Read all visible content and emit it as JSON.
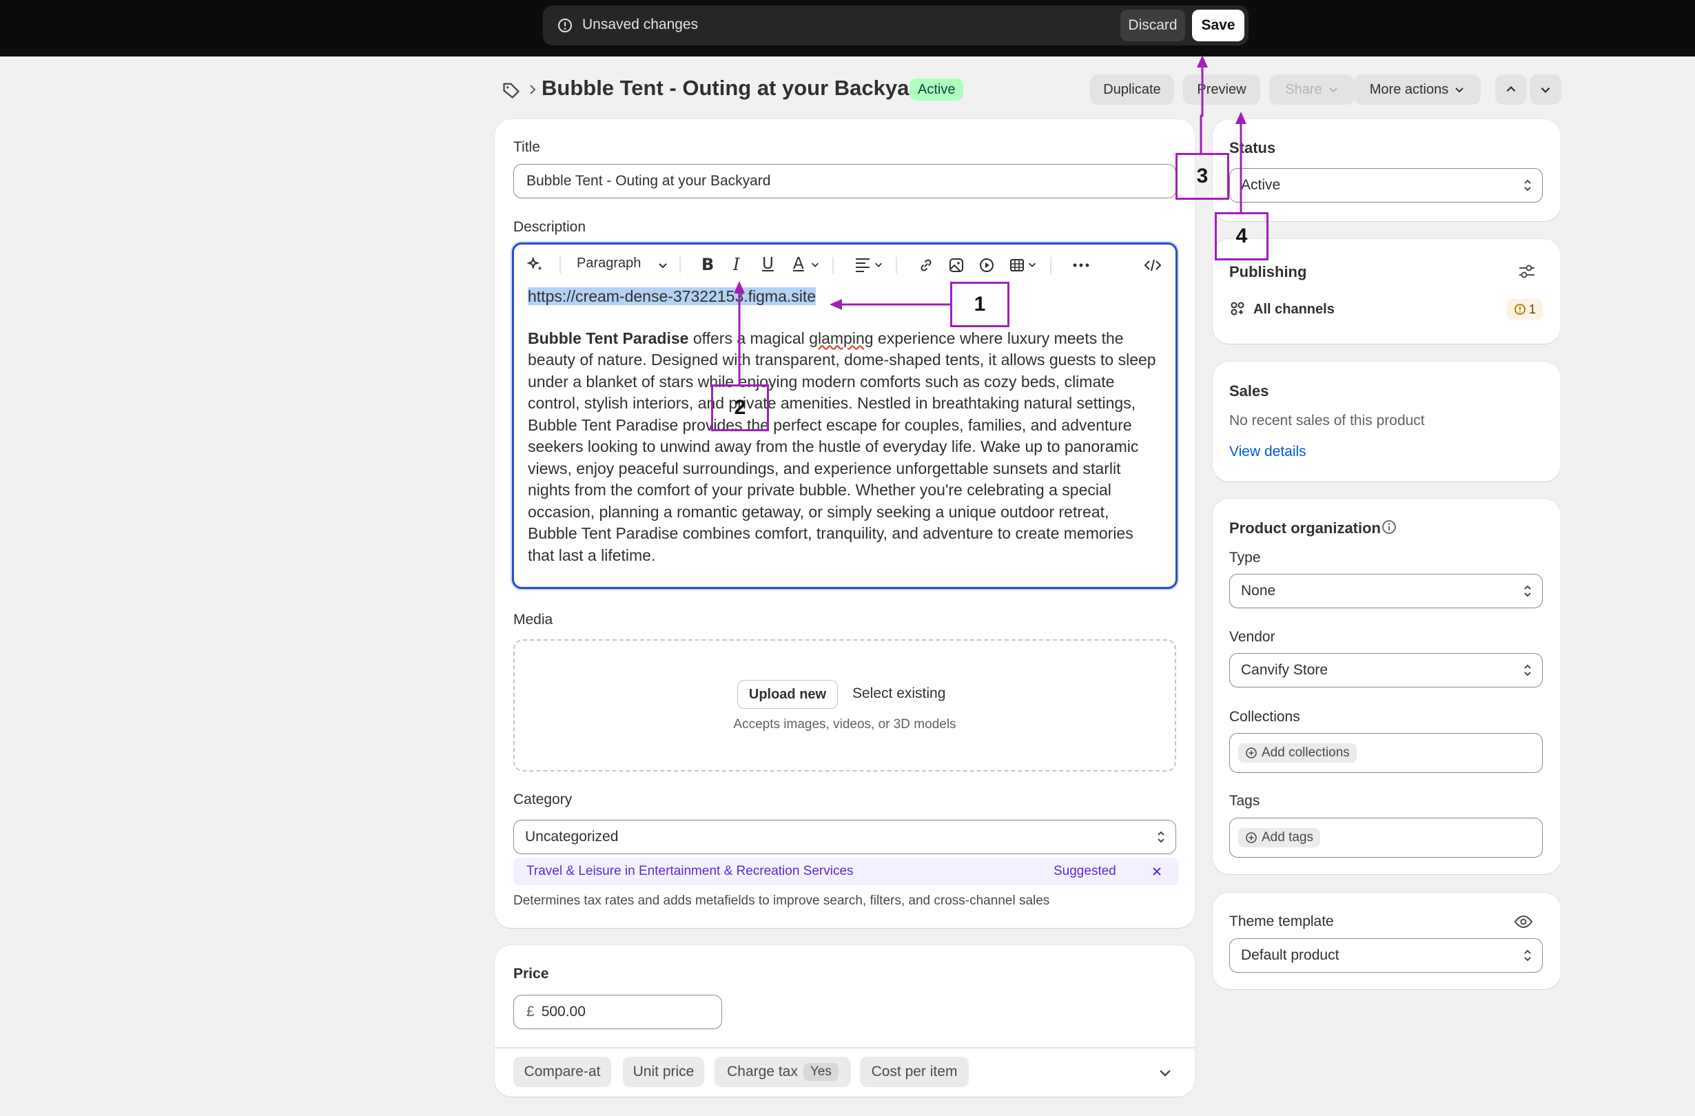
{
  "save_bar": {
    "message": "Unsaved changes",
    "discard_label": "Discard",
    "save_label": "Save"
  },
  "header": {
    "title": "Bubble Tent - Outing at your Backyard",
    "status_badge": "Active",
    "duplicate_label": "Duplicate",
    "preview_label": "Preview",
    "share_label": "Share",
    "more_actions_label": "More actions"
  },
  "main": {
    "title_label": "Title",
    "title_value": "Bubble Tent - Outing at your Backyard",
    "description_label": "Description",
    "toolbar": {
      "paragraph_label": "Paragraph"
    },
    "description": {
      "link_text": "https://cream-dense-37322153.figma.site",
      "bold_lead": "Bubble Tent Paradise",
      "body_before_glamping": " offers a magical ",
      "glamping_word": "glamping",
      "body_rest": " experience where luxury meets the beauty of nature. Designed with transparent, dome-shaped tents, it allows guests to sleep under a blanket of stars while enjoying modern comforts such as cozy beds, climate control, stylish interiors, and private amenities. Nestled in breathtaking natural settings, Bubble Tent Paradise provides the perfect escape for couples, families, and adventure seekers looking to unwind away from the hustle of everyday life. Wake up to panoramic views, enjoy peaceful surroundings, and experience unforgettable sunsets and starlit nights from the comfort of your private bubble. Whether you're celebrating a special occasion, planning a romantic getaway, or simply seeking a unique outdoor retreat, Bubble Tent Paradise combines comfort, tranquility, and adventure to create memories that last a lifetime."
    },
    "media_label": "Media",
    "upload_new_label": "Upload new",
    "select_existing_label": "Select existing",
    "media_hint": "Accepts images, videos, or 3D models",
    "category_label": "Category",
    "category_value": "Uncategorized",
    "suggestion_category": "Travel & Leisure",
    "suggestion_in": " in ",
    "suggestion_parent": "Entertainment & Recreation Services",
    "suggested_label": "Suggested",
    "category_help": "Determines tax rates and adds metafields to improve search, filters, and cross-channel sales",
    "price_label": "Price",
    "currency_symbol": "£",
    "price_value": "500.00",
    "compare_at_label": "Compare-at",
    "unit_price_label": "Unit price",
    "charge_tax_label": "Charge tax",
    "charge_tax_value": "Yes",
    "cost_per_item_label": "Cost per item"
  },
  "sidebar": {
    "status_label": "Status",
    "status_value": "Active",
    "publishing_label": "Publishing",
    "all_channels_label": "All channels",
    "channels_warning_count": "1",
    "sales_label": "Sales",
    "sales_text": "No recent sales of this product",
    "view_details_label": "View details",
    "product_org_label": "Product organization",
    "type_label": "Type",
    "type_value": "None",
    "vendor_label": "Vendor",
    "vendor_value": "Canvify Store",
    "collections_label": "Collections",
    "add_collections_label": "Add collections",
    "tags_label": "Tags",
    "add_tags_label": "Add tags",
    "theme_template_label": "Theme template",
    "theme_template_value": "Default product"
  },
  "annotations": {
    "a1": "1",
    "a2": "2",
    "a3": "3",
    "a4": "4"
  },
  "colors": {
    "annotation": "#a020b8",
    "editor_focus": "#2a4fc4",
    "active_badge_bg": "#affebf",
    "link": "#005bd3",
    "suggestion": "#5c2bd3"
  }
}
